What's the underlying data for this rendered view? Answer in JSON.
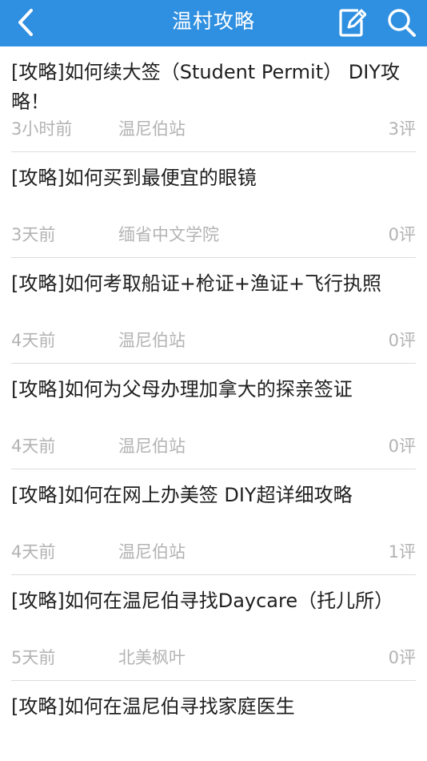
{
  "header": {
    "title": "温村攻略",
    "back_icon": "chevron-left-icon",
    "compose_icon": "edit-icon",
    "search_icon": "search-icon",
    "bar_color": "#2f8fe0"
  },
  "articles": [
    {
      "title": "[攻略]如何续大签（Student Permit） DIY攻略！",
      "time": "3小时前",
      "source": "温尼伯站",
      "comments": "3评"
    },
    {
      "title": "[攻略]如何买到最便宜的眼镜",
      "time": "3天前",
      "source": "缅省中文学院",
      "comments": "0评"
    },
    {
      "title": "[攻略]如何考取船证+枪证+渔证+飞行执照",
      "time": "4天前",
      "source": "温尼伯站",
      "comments": "0评"
    },
    {
      "title": "[攻略]如何为父母办理加拿大的探亲签证",
      "time": "4天前",
      "source": "温尼伯站",
      "comments": "0评"
    },
    {
      "title": "[攻略]如何在网上办美签 DIY超详细攻略",
      "time": "4天前",
      "source": "温尼伯站",
      "comments": "1评"
    },
    {
      "title": "[攻略]如何在温尼伯寻找Daycare（托儿所）",
      "time": "5天前",
      "source": "北美枫叶",
      "comments": "0评"
    },
    {
      "title": "[攻略]如何在温尼伯寻找家庭医生",
      "time": "",
      "source": "",
      "comments": ""
    }
  ]
}
